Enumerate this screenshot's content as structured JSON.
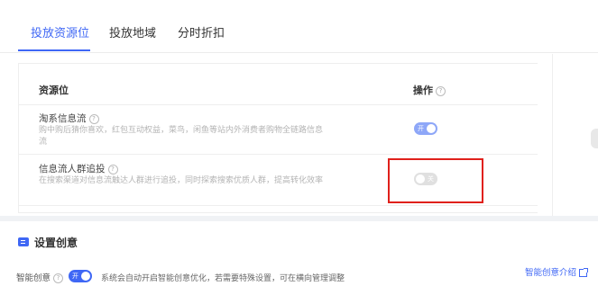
{
  "tabs": [
    {
      "label": "投放资源位",
      "active": true
    },
    {
      "label": "投放地域",
      "active": false
    },
    {
      "label": "分时折扣",
      "active": false
    }
  ],
  "table": {
    "col_resource": "资源位",
    "col_operation": "操作",
    "rows": [
      {
        "title": "淘系信息流",
        "description": "购中购后猜你喜欢，红包互动权益，菜鸟，闲鱼等站内外消费者购物全链路信息流",
        "toggle_label": "开",
        "enabled": true
      },
      {
        "title": "信息流人群追投",
        "description": "在搜索渠道对信息流触达人群进行追投，同时探索搜索优质人群，提高转化效率",
        "toggle_label": "关",
        "enabled": false
      }
    ]
  },
  "creative": {
    "section_title": "设置创意",
    "label": "智能创意",
    "toggle_label": "开",
    "enabled": true,
    "description": "系统会自动开启智能创意优化，若需要特殊设置，可在横向管理调整",
    "link": "智能创意介绍"
  },
  "colors": {
    "accent": "#3f67f5",
    "highlight": "#e0201b"
  }
}
